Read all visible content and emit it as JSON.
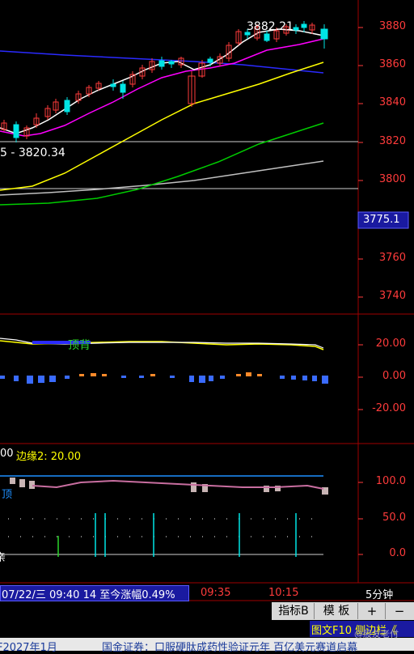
{
  "main_chart": {
    "peak_label": "3882.21",
    "low_label": "5 - 3820.34",
    "price_axis": [
      "3880",
      "3860",
      "3840",
      "3820",
      "3800",
      "3775.1",
      "3760",
      "3740"
    ],
    "current_price": "3775.1"
  },
  "macd_panel": {
    "label": "顶背",
    "axis": [
      "20.00",
      "0.00",
      "-20.00"
    ]
  },
  "indicator_panel": {
    "header_prefix": "00",
    "header_label": "边缘2: 20.00",
    "side_label": "顶",
    "axis": [
      "100.0",
      "50.0",
      "0.0"
    ],
    "bottom_glyph": "亲"
  },
  "status_bar": {
    "info": "07/22/三 09:40 14 至今涨幅0.49%",
    "time_1": "09:35",
    "time_2": "10:15",
    "period": "5分钟"
  },
  "toolbar": {
    "indicator_btn": "指标B",
    "template_btn": "模 板",
    "plus_btn": "+",
    "minus_btn": "−"
  },
  "f10_bar": {
    "text": "图文F10 侧边栏《"
  },
  "ticker": {
    "left_text": "F2027年1月",
    "right_text": "国金证券：口服硬肽成药性验证元年 百亿美元赛道启幕",
    "watermark": "@股友老付"
  },
  "colors": {
    "up": "#ff3b3b",
    "down": "#00e5e5",
    "ma5": "#ffffff",
    "ma10": "#ff00ff",
    "ma20": "#ffff00",
    "ma60": "#00cc00",
    "ma120": "#c0c0c0",
    "ma_blue": "#2a2aff",
    "axis_red": "#ff3b3b",
    "grid_red": "#7a0000"
  }
}
